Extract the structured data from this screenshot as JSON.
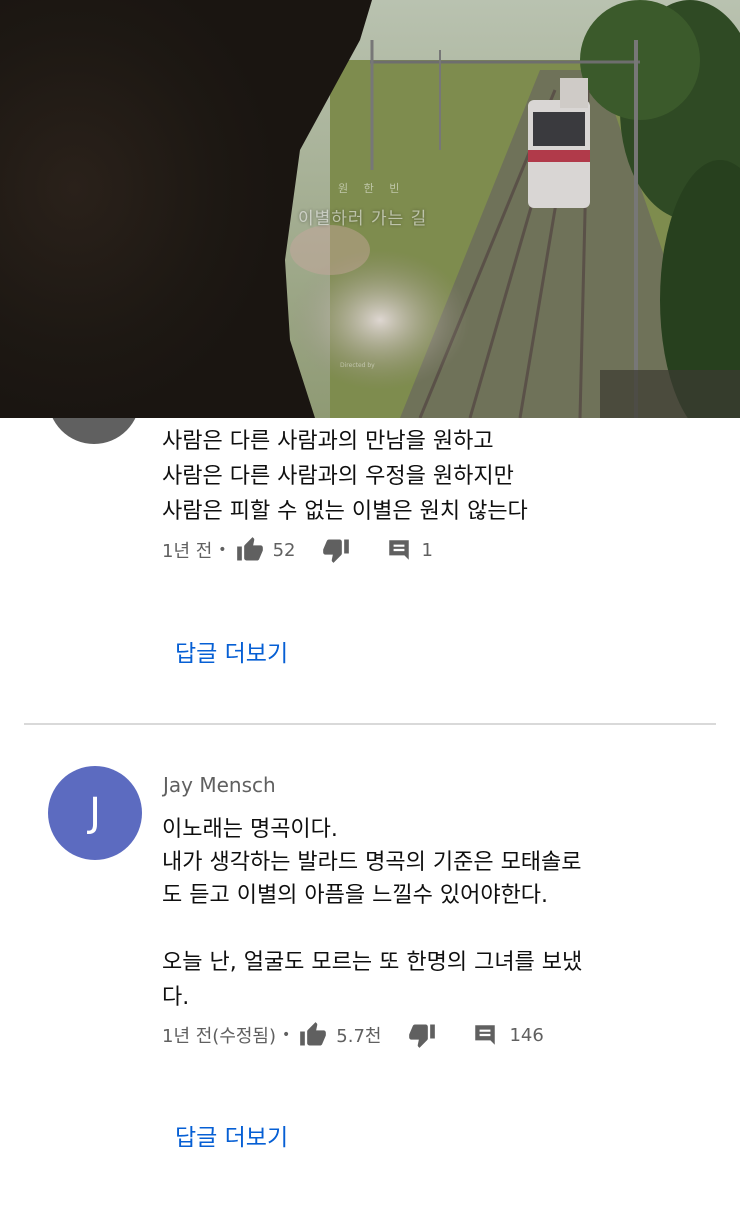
{
  "video": {
    "overlay_artist": "원 한 빈",
    "overlay_title": "이별하러 가는 길",
    "overlay_credit": "Directed by"
  },
  "comments": [
    {
      "lines": [
        "사람은 다른 사람과의 만남을 원하고",
        "사람은 다른 사람과의 우정을 원하지만",
        "사람은 피할 수 없는 이별은 원치 않는다"
      ],
      "time": "1년 전",
      "likes": "52",
      "replies": "1",
      "more_replies_label": "답글 더보기"
    },
    {
      "author": "Jay Mensch",
      "avatar_letter": "J",
      "avatar_color": "#5c6bc0",
      "lines": [
        "이노래는 명곡이다.",
        "내가 생각하는 발라드 명곡의 기준은 모태솔로",
        "도 듣고 이별의 아픔을 느낄수 있어야한다.",
        "",
        "오늘 난, 얼굴도 모르는 또 한명의 그녀를 보냈",
        "다."
      ],
      "time": "1년 전(수정됨)",
      "likes": "5.7천",
      "replies": "146",
      "more_replies_label": "답글 더보기"
    }
  ],
  "icons": {
    "like": "thumbs-up-icon",
    "dislike": "thumbs-down-icon",
    "reply": "comment-icon"
  },
  "colors": {
    "link": "#065fd4",
    "meta": "#606060"
  }
}
